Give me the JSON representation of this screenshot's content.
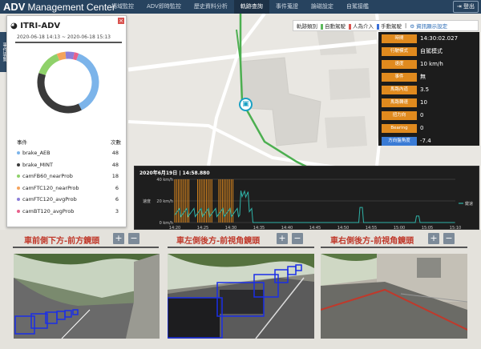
{
  "header": {
    "brand_abbr": "ADV",
    "brand_name": "Management Center",
    "nav": [
      "場域監控",
      "ADV即時監控",
      "歷史資料分析",
      "軌跡查詢",
      "事件蒐證",
      "論磁設定",
      "自駕接艦"
    ],
    "active_nav": 3,
    "logout_label": "登出"
  },
  "sidebar_tab": {
    "label": "事件導覽"
  },
  "event_panel": {
    "title": "ITRI-ADV",
    "date_range": "2020-06-18 14:13 ~ 2020-06-18 15:13",
    "col_event": "事件",
    "col_count": "次數",
    "events": [
      {
        "name": "brake_AEB",
        "count": "48",
        "color": "#7cb4ea"
      },
      {
        "name": "brake_MINT",
        "count": "48",
        "color": "#3a3a3a"
      },
      {
        "name": "camFB60_nearProb",
        "count": "18",
        "color": "#8fd16a"
      },
      {
        "name": "camFTC120_nearProb",
        "count": "6",
        "color": "#f5a35c"
      },
      {
        "name": "camFTC120_avgProb",
        "count": "6",
        "color": "#8c7ed8"
      },
      {
        "name": "camBT120_avgProb",
        "count": "3",
        "color": "#e8618c"
      }
    ]
  },
  "legend": {
    "label": "軌跡類別",
    "items": [
      {
        "name": "自動駕駛",
        "color": "#5cb85c"
      },
      {
        "name": "人為介入",
        "color": "#d9534f"
      },
      {
        "name": "手動駕駛",
        "color": "#3a6fd8"
      }
    ],
    "settings_label": "資訊顯示設定"
  },
  "info": {
    "rows": [
      {
        "label": "時間",
        "value": "14:30:02.027",
        "color": "#e08a1e"
      },
      {
        "label": "行駛模式",
        "value": "自駕模式",
        "color": "#e08a1e"
      },
      {
        "label": "速度",
        "value": "10 km/h",
        "color": "#e08a1e"
      },
      {
        "label": "事件",
        "value": "無",
        "color": "#e08a1e"
      },
      {
        "label": "馬路內道",
        "value": "3.5",
        "color": "#e08a1e"
      },
      {
        "label": "馬路轉速",
        "value": "10",
        "color": "#e08a1e"
      },
      {
        "label": "扭力向",
        "value": "0",
        "color": "#e08a1e"
      },
      {
        "label": "Bearing",
        "value": "0",
        "color": "#e08a1e"
      },
      {
        "label": "方向盤角度",
        "value": "-7.4",
        "color": "#3a7bd5"
      }
    ]
  },
  "chart_data": {
    "type": "line",
    "title": "2020年6月19日 | 14:58.880",
    "ylabel": "速度",
    "ylim": [
      0,
      40
    ],
    "y_ticks": [
      "40 km/h",
      "20 km/h",
      "0 km/h"
    ],
    "x_ticks": [
      "14:20",
      "14:25",
      "14:30",
      "14:35",
      "14:40",
      "14:45",
      "14:50",
      "14:55",
      "15:00",
      "15:05",
      "15:10"
    ],
    "series": [
      {
        "name": "鍵速",
        "color": "#2fb3a8"
      }
    ],
    "event_band": {
      "start": "14:20",
      "end": "14:31",
      "color": "#e08a1e"
    }
  },
  "cameras": [
    {
      "title": "車前側下方-前方鏡頭",
      "plus": "+",
      "minus": "−"
    },
    {
      "title": "車左側後方-前視角鏡頭",
      "plus": "+",
      "minus": "−"
    },
    {
      "title": "車右側後方-前視角鏡頭",
      "plus": "+",
      "minus": "−"
    }
  ],
  "map": {
    "marker_icon": "bus-icon"
  }
}
